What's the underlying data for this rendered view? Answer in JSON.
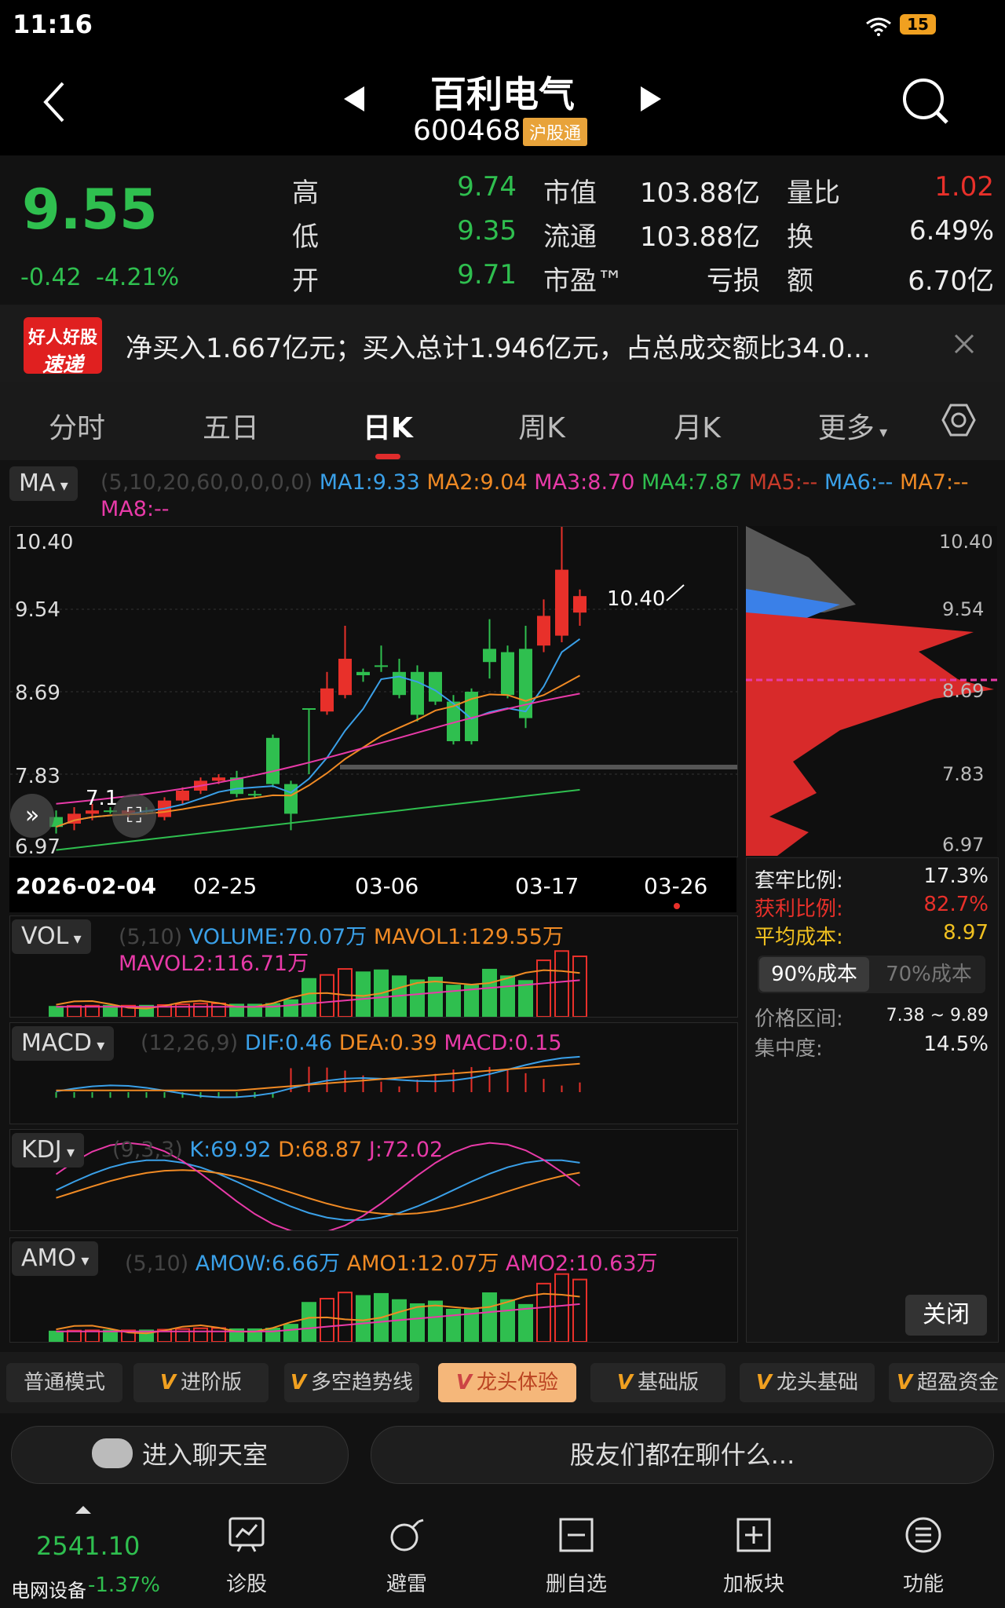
{
  "status_bar": {
    "time": "11:16",
    "battery": "15"
  },
  "header": {
    "title": "百利电气",
    "code": "600468",
    "badge": "沪股通"
  },
  "quote": {
    "price": "9.55",
    "change": "-0.42",
    "change_pct": "-4.21%",
    "rows": [
      {
        "l1": "高",
        "v1": "9.74",
        "l2": "市值",
        "v2": "103.88亿",
        "l3": "量比",
        "v3": "1.02"
      },
      {
        "l1": "低",
        "v1": "9.35",
        "l2": "流通",
        "v2": "103.88亿",
        "l3": "换",
        "v3": "6.49%"
      },
      {
        "l1": "开",
        "v1": "9.71",
        "l2": "市盈™",
        "v2": "亏损",
        "l3": "额",
        "v3": "6.70亿"
      }
    ]
  },
  "news": {
    "logo_top": "好人好股",
    "logo_bottom": "速递",
    "text": "净买入1.667亿元；买入总计1.946亿元，占总成交额比34.0..."
  },
  "tabs": [
    "分时",
    "五日",
    "日K",
    "周K",
    "月K",
    "更多"
  ],
  "ma": {
    "selector": "MA",
    "params": "(5,10,20,60,0,0,0,0)",
    "items": [
      "MA1:9.33",
      "MA2:9.04",
      "MA3:8.70",
      "MA4:7.87",
      "MA5:--",
      "MA6:--",
      "MA7:--",
      "MA8:--"
    ]
  },
  "price_axis": [
    "10.40",
    "9.54",
    "8.69",
    "7.83",
    "6.97"
  ],
  "dates": [
    "2026-02-04",
    "02-25",
    "03-06",
    "03-17",
    "03-26"
  ],
  "annotations": {
    "high": "10.40",
    "low": "7.1"
  },
  "indicators": {
    "vol": {
      "selector": "VOL",
      "params": "(5,10)",
      "items": [
        "VOLUME:70.07万",
        "MAVOL1:129.55万",
        "MAVOL2:116.71万"
      ]
    },
    "macd": {
      "selector": "MACD",
      "params": "(12,26,9)",
      "items": [
        "DIF:0.46",
        "DEA:0.39",
        "MACD:0.15"
      ]
    },
    "kdj": {
      "selector": "KDJ",
      "params": "(9,3,3)",
      "items": [
        "K:69.92",
        "D:68.87",
        "J:72.02"
      ]
    },
    "amo": {
      "selector": "AMO",
      "params": "(5,10)",
      "items": [
        "AMOW:6.66万",
        "AMO1:12.07万",
        "AMO2:10.63万"
      ]
    }
  },
  "chips": {
    "trapped_label": "套牢比例:",
    "trapped": "17.3%",
    "profit_label": "获利比例:",
    "profit": "82.7%",
    "avgcost_label": "平均成本:",
    "avgcost": "8.97",
    "tab90": "90%成本",
    "tab70": "70%成本",
    "range_label": "价格区间:",
    "range": "7.38 ~ 9.89",
    "conc_label": "集中度:",
    "conc": "14.5%",
    "close": "关闭"
  },
  "modes": [
    "普通模式",
    "进阶版",
    "多空趋势线",
    "龙头体验",
    "基础版",
    "龙头基础",
    "超盈资金"
  ],
  "chat": {
    "enter": "进入聊天室",
    "topic": "股友们都在聊什么..."
  },
  "index": {
    "value": "2541.10",
    "name": "电网设备",
    "pct": "-1.37%"
  },
  "nav": [
    "诊股",
    "避雷",
    "删自选",
    "加板块",
    "功能"
  ],
  "colors": {
    "up": "#e8302a",
    "down": "#2fbf4f",
    "ma1": "#3aa0e8",
    "ma2": "#f08a24",
    "ma3": "#e83aa8",
    "ma4": "#2fbf4f"
  }
}
